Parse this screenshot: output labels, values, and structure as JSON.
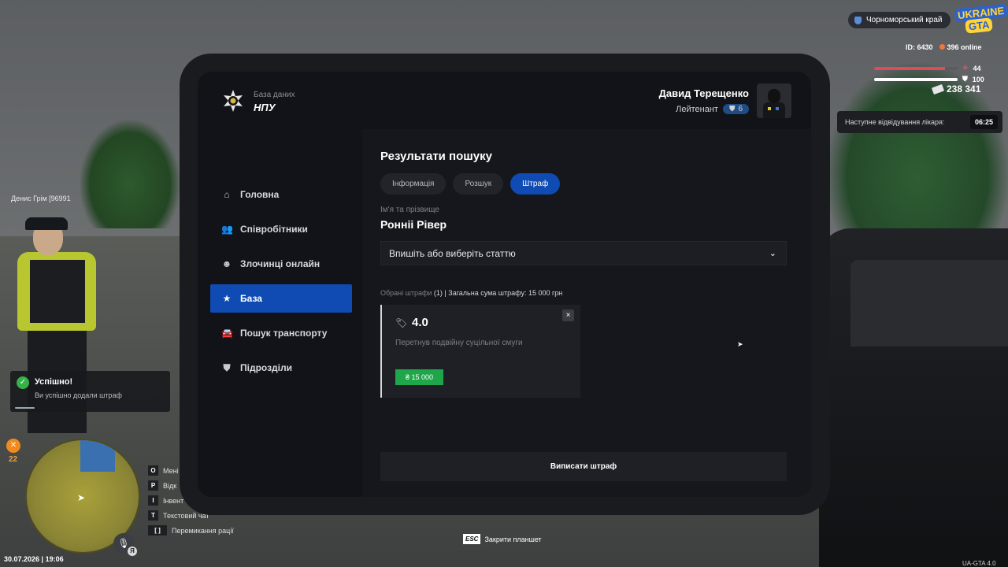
{
  "hud": {
    "region": "Чорноморський край",
    "logo_line1": "UKRAINE",
    "logo_line2": "GTA",
    "id": "ID: 6430",
    "online": "396 online",
    "health": {
      "value": "44",
      "level": 0.85,
      "color": "#e14a5a"
    },
    "armor": {
      "value": "100",
      "level": 1.0,
      "color": "#ffffff"
    },
    "money": "238 341",
    "doctor_label": "Наступне відвідування лікаря:",
    "doctor_time": "06:25",
    "player_tag": "Денис Грім [96991",
    "hunger_value": "22",
    "toast": {
      "title": "Успішно!",
      "text": "Ви успішно додали штраф"
    },
    "keys": [
      {
        "key": "O",
        "label": "Мені"
      },
      {
        "key": "P",
        "label": "Відк"
      },
      {
        "key": "I",
        "label": "Інвент"
      },
      {
        "key": "T",
        "label": "Текстовий чат"
      },
      {
        "key": "[ ]",
        "label": "Перемикання рації"
      }
    ],
    "mic_badge": "Я",
    "datetime": "30.07.2026 | 19:06",
    "esc_key": "ESC",
    "esc_label": "Закрити планшет",
    "version": "UA-GTA 4.0"
  },
  "tablet": {
    "logo_sub": "База даних",
    "logo_title": "НПУ",
    "nav": [
      {
        "label": "Головна",
        "icon": "home-icon",
        "active": false
      },
      {
        "label": "Співробітники",
        "icon": "users-icon",
        "active": false
      },
      {
        "label": "Злочинці онлайн",
        "icon": "criminal-icon",
        "active": false
      },
      {
        "label": "База",
        "icon": "star-icon",
        "active": true
      },
      {
        "label": "Пошук транспорту",
        "icon": "car-icon",
        "active": false
      },
      {
        "label": "Підрозділи",
        "icon": "shield-icon",
        "active": false
      }
    ],
    "user": {
      "name": "Давид Терещенко",
      "rank": "Лейтенант",
      "rank_level": "6"
    },
    "results_title": "Результати пошуку",
    "tabs": [
      {
        "label": "Інформація",
        "active": false
      },
      {
        "label": "Розшук",
        "active": false
      },
      {
        "label": "Штраф",
        "active": true
      }
    ],
    "name_label": "Ім'я та прізвище",
    "name_value": "Ронніі Рівер",
    "select_placeholder": "Впишіть або виберіть статтю",
    "summary_prefix": "Обрані штрафи",
    "summary_rest": " (1) | Загальна сума штрафу: 15 000 грн",
    "fine": {
      "code": "4.0",
      "description": "Перетнув подвійну суцільної смуги",
      "amount": "₴ 15 000",
      "close": "×"
    },
    "submit_label": "Виписати штраф"
  }
}
